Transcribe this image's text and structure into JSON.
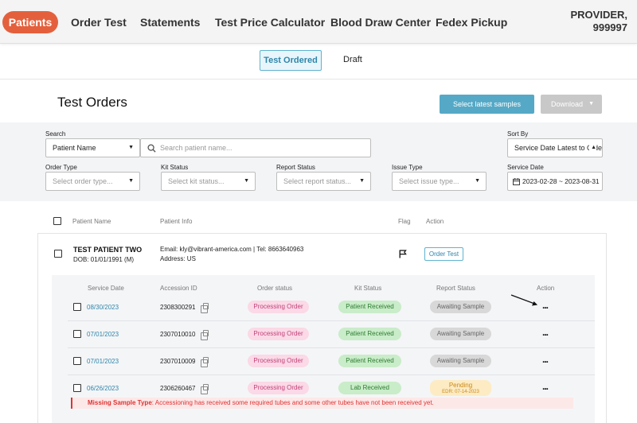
{
  "nav": {
    "items": [
      "Patients",
      "Order Test",
      "Statements",
      "Test Price Calculator",
      "Blood Draw Center",
      "Fedex Pickup"
    ],
    "provider_line1": "PROVIDER,",
    "provider_line2": "999997"
  },
  "subtabs": [
    "Test Ordered",
    "Draft"
  ],
  "page_title": "Test Orders",
  "actions": {
    "select_latest": "Select latest samples",
    "download": "Download"
  },
  "filters": {
    "search_label": "Search",
    "search_type": "Patient Name",
    "search_placeholder": "Search patient name...",
    "sort_label": "Sort By",
    "sort_value": "Service Date Latest to Oldest",
    "order_type_label": "Order Type",
    "order_type_placeholder": "Select order type...",
    "kit_status_label": "Kit Status",
    "kit_status_placeholder": "Select kit status...",
    "report_status_label": "Report Status",
    "report_status_placeholder": "Select report status...",
    "issue_type_label": "Issue Type",
    "issue_type_placeholder": "Select issue type...",
    "service_date_label": "Service Date",
    "service_date_value": "2023-02-28 ~ 2023-08-31"
  },
  "columns": {
    "patient_name": "Patient Name",
    "patient_info": "Patient Info",
    "flag": "Flag",
    "action": "Action"
  },
  "patient": {
    "name": "TEST PATIENT TWO",
    "dob": "DOB: 01/01/1991  (M)",
    "contact": "Email: kly@vibrant-america.com  |  Tel: 8663640963",
    "address": "Address: US",
    "order_test": "Order Test"
  },
  "sub_columns": {
    "service_date": "Service Date",
    "accession_id": "Accession ID",
    "order_status": "Order status",
    "kit_status": "Kit Status",
    "report_status": "Report Status",
    "action": "Action"
  },
  "orders": [
    {
      "date": "08/30/2023",
      "accession": "2308300291",
      "order_status": "Processing Order",
      "kit_status": "Patient Received",
      "report_status": "Awaiting Sample",
      "action": "..."
    },
    {
      "date": "07/01/2023",
      "accession": "2307010010",
      "order_status": "Processing Order",
      "kit_status": "Patient Received",
      "report_status": "Awaiting Sample",
      "action": "..."
    },
    {
      "date": "07/01/2023",
      "accession": "2307010009",
      "order_status": "Processing Order",
      "kit_status": "Patient Received",
      "report_status": "Awaiting Sample",
      "action": "..."
    },
    {
      "date": "06/26/2023",
      "accession": "2306260467",
      "order_status": "Processing Order",
      "kit_status": "Lab Received",
      "report_status": "Pending",
      "report_sub": "EDR: 07-14-2023",
      "action": "..."
    }
  ],
  "alert": {
    "title": "Missing Sample Type",
    "message": ": Accessioning has received some required tubes and some other tubes have not been received yet."
  },
  "colors": {
    "brand": "#e4603d",
    "accent": "#55a9c6",
    "link": "#2e86ab",
    "order_pill": "#fbd9e6",
    "kit_pill": "#c9ecc9",
    "report_pill": "#d8d8d8",
    "pending_pill": "#fdebc4",
    "alert": "#d33333"
  }
}
